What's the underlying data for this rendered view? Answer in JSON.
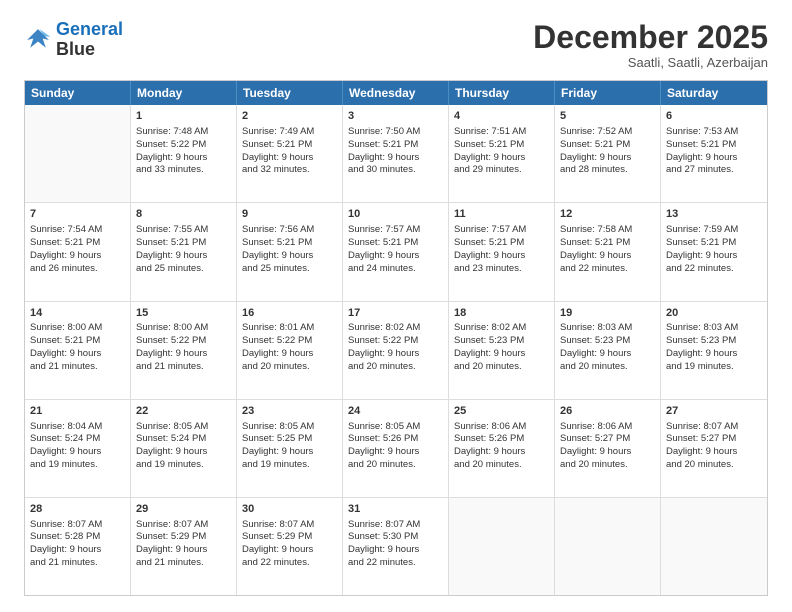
{
  "logo": {
    "line1": "General",
    "line2": "Blue"
  },
  "title": "December 2025",
  "subtitle": "Saatli, Saatli, Azerbaijan",
  "header_days": [
    "Sunday",
    "Monday",
    "Tuesday",
    "Wednesday",
    "Thursday",
    "Friday",
    "Saturday"
  ],
  "weeks": [
    [
      {
        "day": "",
        "lines": []
      },
      {
        "day": "1",
        "lines": [
          "Sunrise: 7:48 AM",
          "Sunset: 5:22 PM",
          "Daylight: 9 hours",
          "and 33 minutes."
        ]
      },
      {
        "day": "2",
        "lines": [
          "Sunrise: 7:49 AM",
          "Sunset: 5:21 PM",
          "Daylight: 9 hours",
          "and 32 minutes."
        ]
      },
      {
        "day": "3",
        "lines": [
          "Sunrise: 7:50 AM",
          "Sunset: 5:21 PM",
          "Daylight: 9 hours",
          "and 30 minutes."
        ]
      },
      {
        "day": "4",
        "lines": [
          "Sunrise: 7:51 AM",
          "Sunset: 5:21 PM",
          "Daylight: 9 hours",
          "and 29 minutes."
        ]
      },
      {
        "day": "5",
        "lines": [
          "Sunrise: 7:52 AM",
          "Sunset: 5:21 PM",
          "Daylight: 9 hours",
          "and 28 minutes."
        ]
      },
      {
        "day": "6",
        "lines": [
          "Sunrise: 7:53 AM",
          "Sunset: 5:21 PM",
          "Daylight: 9 hours",
          "and 27 minutes."
        ]
      }
    ],
    [
      {
        "day": "7",
        "lines": [
          "Sunrise: 7:54 AM",
          "Sunset: 5:21 PM",
          "Daylight: 9 hours",
          "and 26 minutes."
        ]
      },
      {
        "day": "8",
        "lines": [
          "Sunrise: 7:55 AM",
          "Sunset: 5:21 PM",
          "Daylight: 9 hours",
          "and 25 minutes."
        ]
      },
      {
        "day": "9",
        "lines": [
          "Sunrise: 7:56 AM",
          "Sunset: 5:21 PM",
          "Daylight: 9 hours",
          "and 25 minutes."
        ]
      },
      {
        "day": "10",
        "lines": [
          "Sunrise: 7:57 AM",
          "Sunset: 5:21 PM",
          "Daylight: 9 hours",
          "and 24 minutes."
        ]
      },
      {
        "day": "11",
        "lines": [
          "Sunrise: 7:57 AM",
          "Sunset: 5:21 PM",
          "Daylight: 9 hours",
          "and 23 minutes."
        ]
      },
      {
        "day": "12",
        "lines": [
          "Sunrise: 7:58 AM",
          "Sunset: 5:21 PM",
          "Daylight: 9 hours",
          "and 22 minutes."
        ]
      },
      {
        "day": "13",
        "lines": [
          "Sunrise: 7:59 AM",
          "Sunset: 5:21 PM",
          "Daylight: 9 hours",
          "and 22 minutes."
        ]
      }
    ],
    [
      {
        "day": "14",
        "lines": [
          "Sunrise: 8:00 AM",
          "Sunset: 5:21 PM",
          "Daylight: 9 hours",
          "and 21 minutes."
        ]
      },
      {
        "day": "15",
        "lines": [
          "Sunrise: 8:00 AM",
          "Sunset: 5:22 PM",
          "Daylight: 9 hours",
          "and 21 minutes."
        ]
      },
      {
        "day": "16",
        "lines": [
          "Sunrise: 8:01 AM",
          "Sunset: 5:22 PM",
          "Daylight: 9 hours",
          "and 20 minutes."
        ]
      },
      {
        "day": "17",
        "lines": [
          "Sunrise: 8:02 AM",
          "Sunset: 5:22 PM",
          "Daylight: 9 hours",
          "and 20 minutes."
        ]
      },
      {
        "day": "18",
        "lines": [
          "Sunrise: 8:02 AM",
          "Sunset: 5:23 PM",
          "Daylight: 9 hours",
          "and 20 minutes."
        ]
      },
      {
        "day": "19",
        "lines": [
          "Sunrise: 8:03 AM",
          "Sunset: 5:23 PM",
          "Daylight: 9 hours",
          "and 20 minutes."
        ]
      },
      {
        "day": "20",
        "lines": [
          "Sunrise: 8:03 AM",
          "Sunset: 5:23 PM",
          "Daylight: 9 hours",
          "and 19 minutes."
        ]
      }
    ],
    [
      {
        "day": "21",
        "lines": [
          "Sunrise: 8:04 AM",
          "Sunset: 5:24 PM",
          "Daylight: 9 hours",
          "and 19 minutes."
        ]
      },
      {
        "day": "22",
        "lines": [
          "Sunrise: 8:05 AM",
          "Sunset: 5:24 PM",
          "Daylight: 9 hours",
          "and 19 minutes."
        ]
      },
      {
        "day": "23",
        "lines": [
          "Sunrise: 8:05 AM",
          "Sunset: 5:25 PM",
          "Daylight: 9 hours",
          "and 19 minutes."
        ]
      },
      {
        "day": "24",
        "lines": [
          "Sunrise: 8:05 AM",
          "Sunset: 5:26 PM",
          "Daylight: 9 hours",
          "and 20 minutes."
        ]
      },
      {
        "day": "25",
        "lines": [
          "Sunrise: 8:06 AM",
          "Sunset: 5:26 PM",
          "Daylight: 9 hours",
          "and 20 minutes."
        ]
      },
      {
        "day": "26",
        "lines": [
          "Sunrise: 8:06 AM",
          "Sunset: 5:27 PM",
          "Daylight: 9 hours",
          "and 20 minutes."
        ]
      },
      {
        "day": "27",
        "lines": [
          "Sunrise: 8:07 AM",
          "Sunset: 5:27 PM",
          "Daylight: 9 hours",
          "and 20 minutes."
        ]
      }
    ],
    [
      {
        "day": "28",
        "lines": [
          "Sunrise: 8:07 AM",
          "Sunset: 5:28 PM",
          "Daylight: 9 hours",
          "and 21 minutes."
        ]
      },
      {
        "day": "29",
        "lines": [
          "Sunrise: 8:07 AM",
          "Sunset: 5:29 PM",
          "Daylight: 9 hours",
          "and 21 minutes."
        ]
      },
      {
        "day": "30",
        "lines": [
          "Sunrise: 8:07 AM",
          "Sunset: 5:29 PM",
          "Daylight: 9 hours",
          "and 22 minutes."
        ]
      },
      {
        "day": "31",
        "lines": [
          "Sunrise: 8:07 AM",
          "Sunset: 5:30 PM",
          "Daylight: 9 hours",
          "and 22 minutes."
        ]
      },
      {
        "day": "",
        "lines": []
      },
      {
        "day": "",
        "lines": []
      },
      {
        "day": "",
        "lines": []
      }
    ]
  ]
}
